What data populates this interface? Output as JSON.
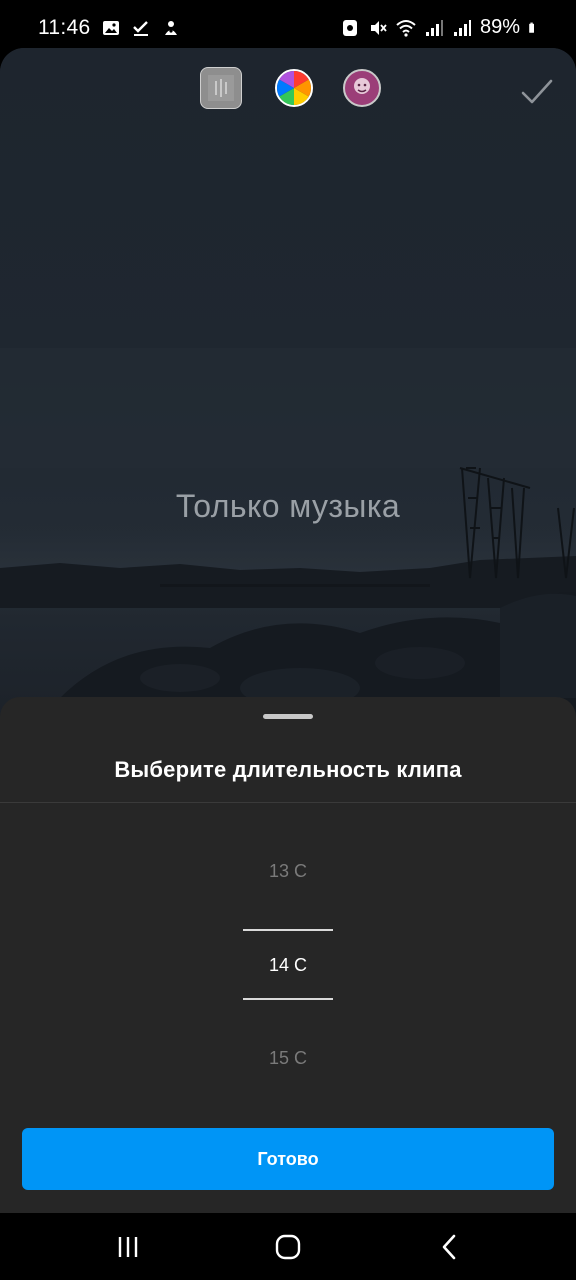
{
  "status_bar": {
    "time": "11:46",
    "left_icons": [
      "gallery-icon",
      "check-download-icon",
      "app-notification-icon"
    ],
    "right_icons": [
      "nfc-icon",
      "mute-icon",
      "wifi-icon",
      "signal-icon",
      "signal-icon-2",
      "battery-icon"
    ],
    "battery": "89%"
  },
  "editor": {
    "toolbar": {
      "tools": [
        "background-tool",
        "color-wheel-tool",
        "sticker-tool"
      ],
      "confirm_icon": "checkmark-icon"
    },
    "overlay_text": "Только музыка",
    "colors": {
      "accent": "#0095f6",
      "sheet": "#262626",
      "canvas": "#1d242d"
    }
  },
  "sheet": {
    "title": "Выберите длительность клипа",
    "picker": {
      "items": [
        "13 С",
        "14 С",
        "15 С"
      ],
      "selected": "14 С"
    },
    "done_label": "Готово"
  },
  "nav_bar": {
    "buttons": [
      "recent-apps-icon",
      "home-icon",
      "back-icon"
    ]
  }
}
